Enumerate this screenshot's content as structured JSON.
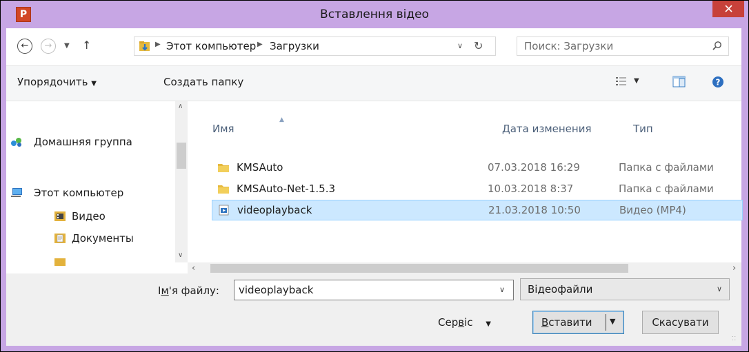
{
  "window": {
    "title": "Вставлення відео",
    "app_icon_letter": "P",
    "close_glyph": "✕"
  },
  "address": {
    "crumbs": [
      "Этот компьютер",
      "Загрузки"
    ],
    "search_placeholder": "Поиск: Загрузки"
  },
  "toolbar": {
    "organize": "Упорядочить",
    "new_folder": "Создать папку"
  },
  "nav": {
    "items": [
      {
        "label": "Домашняя группа",
        "icon": "homegroup-icon"
      },
      {
        "label": "Этот компьютер",
        "icon": "computer-icon"
      },
      {
        "label": "Видео",
        "icon": "video-folder-icon"
      },
      {
        "label": "Документы",
        "icon": "documents-folder-icon"
      }
    ]
  },
  "columns": {
    "name": "Имя",
    "date": "Дата изменения",
    "type": "Тип"
  },
  "files": [
    {
      "name": "KMSAuto",
      "date": "07.03.2018 16:29",
      "type": "Папка с файлами",
      "icon": "folder-icon"
    },
    {
      "name": "KMSAuto-Net-1.5.3",
      "date": "10.03.2018 8:37",
      "type": "Папка с файлами",
      "icon": "folder-icon"
    },
    {
      "name": "videoplayback",
      "date": "21.03.2018 10:50",
      "type": "Видео (MP4)",
      "icon": "video-file-icon",
      "selected": true
    }
  ],
  "bottom": {
    "filename_label_prefix": "І",
    "filename_label_underlined": "м",
    "filename_label_suffix": "'я файлу:",
    "filename_value": "videoplayback",
    "filetype_value": "Відеофайли",
    "service_prefix": "Сер",
    "service_underlined": "в",
    "service_suffix": "іс",
    "insert_underlined": "В",
    "insert_suffix": "ставити",
    "cancel": "Скасувати"
  },
  "colors": {
    "frame": "#c7a6e4",
    "close": "#c7413a",
    "selection": "#cce8ff",
    "column_header": "#4c607a"
  }
}
